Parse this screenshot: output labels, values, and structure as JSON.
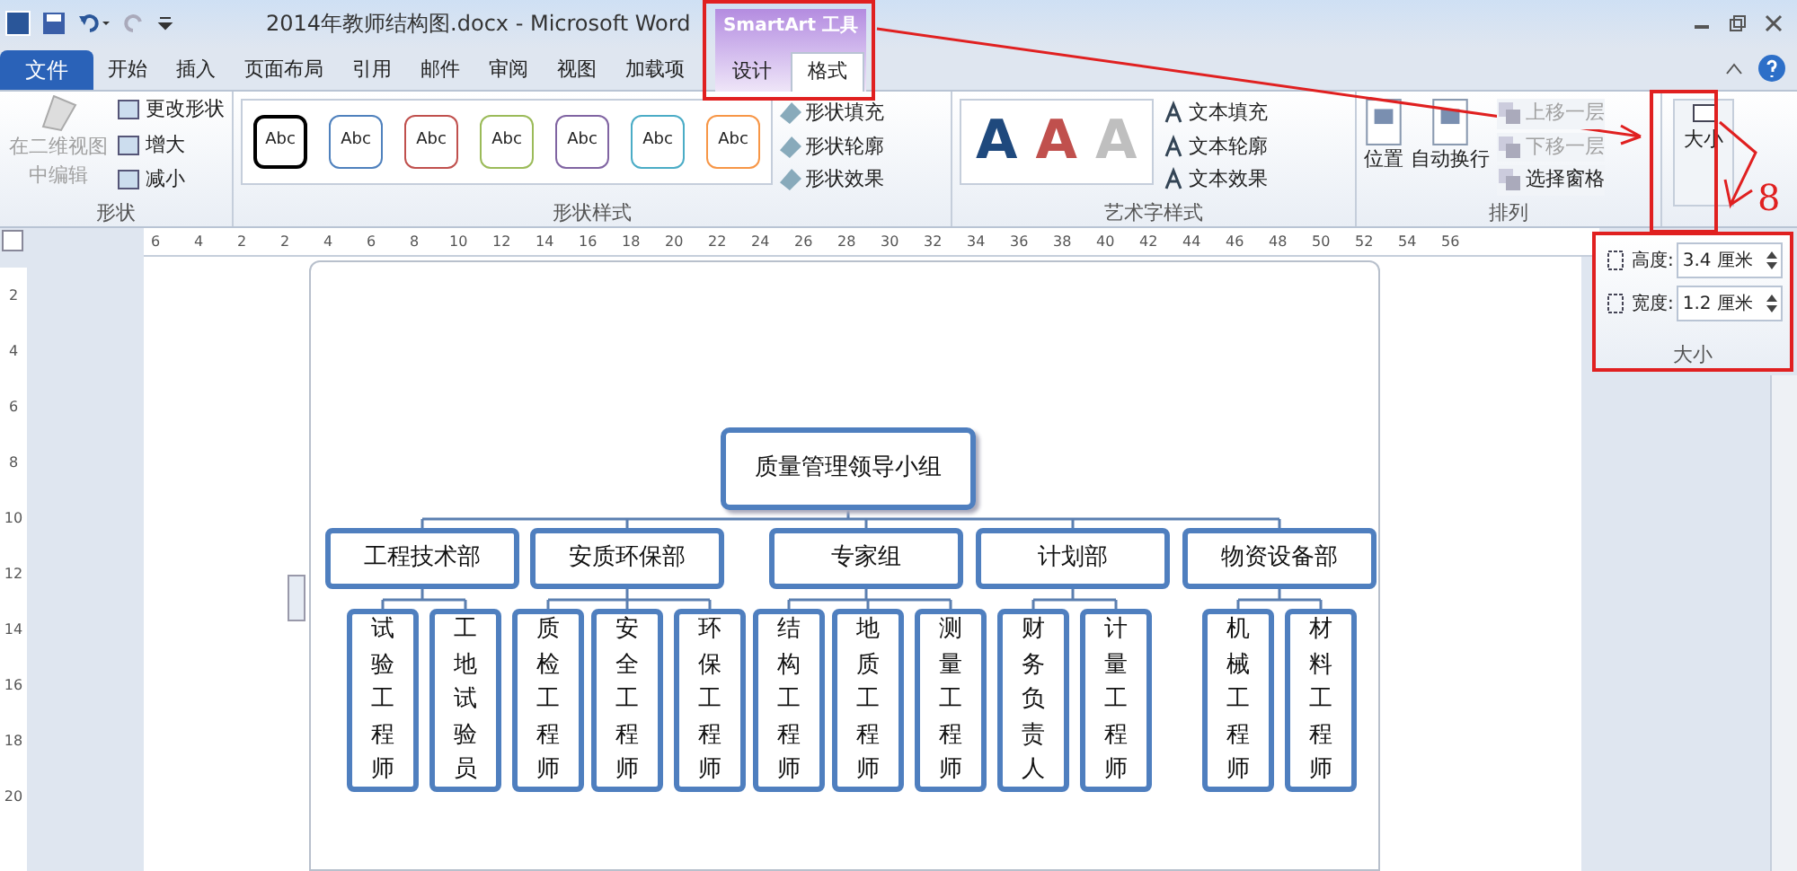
{
  "window": {
    "title": "2014年教师结构图.docx - Microsoft Word"
  },
  "contextual_group": {
    "title": "SmartArt 工具",
    "tabs": [
      {
        "label": "设计",
        "selected": false
      },
      {
        "label": "格式",
        "selected": true
      }
    ]
  },
  "ribbon_tabs": [
    {
      "label": "文件",
      "kind": "file",
      "selected": false
    },
    {
      "label": "开始",
      "kind": "tab",
      "selected": false
    },
    {
      "label": "插入",
      "kind": "tab",
      "selected": false
    },
    {
      "label": "页面布局",
      "kind": "tab",
      "selected": false
    },
    {
      "label": "引用",
      "kind": "tab",
      "selected": false
    },
    {
      "label": "邮件",
      "kind": "tab",
      "selected": false
    },
    {
      "label": "审阅",
      "kind": "tab",
      "selected": false
    },
    {
      "label": "视图",
      "kind": "tab",
      "selected": false
    },
    {
      "label": "加载项",
      "kind": "tab",
      "selected": false
    }
  ],
  "shape_group": {
    "title": "形状",
    "edit_button": {
      "label": "在二维视图中编辑",
      "disabled": true
    },
    "commands": [
      "更改形状",
      "增大",
      "减小"
    ]
  },
  "shape_styles": {
    "title": "形状样式",
    "swatches": [
      {
        "label": "Abc",
        "color": "#000000",
        "selected": true
      },
      {
        "label": "Abc",
        "color": "#4f81bd",
        "selected": false
      },
      {
        "label": "Abc",
        "color": "#c0504d",
        "selected": false
      },
      {
        "label": "Abc",
        "color": "#9bbb59",
        "selected": false
      },
      {
        "label": "Abc",
        "color": "#8064a2",
        "selected": false
      },
      {
        "label": "Abc",
        "color": "#4bacc6",
        "selected": false
      },
      {
        "label": "Abc",
        "color": "#f79646",
        "selected": false
      }
    ],
    "commands": [
      "形状填充",
      "形状轮廓",
      "形状效果"
    ]
  },
  "wordart_styles": {
    "title": "艺术字样式",
    "samples": [
      {
        "label": "A",
        "color": "#1f497d"
      },
      {
        "label": "A",
        "color": "#c0504d"
      },
      {
        "label": "A",
        "color": "#bfbfbf"
      }
    ],
    "commands": [
      "文本填充",
      "文本轮廓",
      "文本效果"
    ]
  },
  "arrange": {
    "title": "排列",
    "buttons": [
      "位置",
      "自动换行"
    ],
    "commands": [
      {
        "label": "上移一层",
        "disabled": true
      },
      {
        "label": "下移一层",
        "disabled": true
      },
      {
        "label": "选择窗格",
        "disabled": false
      }
    ]
  },
  "size_button": {
    "label": "大小"
  },
  "size_panel": {
    "title": "大小",
    "fields": [
      {
        "label": "高度:",
        "value": "3.4 厘米"
      },
      {
        "label": "宽度:",
        "value": "1.2 厘米"
      }
    ]
  },
  "ruler": {
    "horizontal": [
      "6",
      "4",
      "2",
      "2",
      "4",
      "6",
      "8",
      "10",
      "12",
      "14",
      "16",
      "18",
      "20",
      "22",
      "24",
      "26",
      "28",
      "30",
      "32",
      "34",
      "36",
      "38",
      "40",
      "42",
      "44",
      "46",
      "48",
      "50",
      "52",
      "54",
      "56"
    ],
    "vertical": [
      "2",
      "4",
      "6",
      "8",
      "10",
      "12",
      "14",
      "16",
      "18",
      "20"
    ]
  },
  "org_chart": {
    "root": "质量管理领导小组",
    "departments": [
      {
        "name": "工程技术部",
        "children": [
          "试验工程师",
          "工地试验员"
        ]
      },
      {
        "name": "安质环保部",
        "children": [
          "质检工程师",
          "安全工程师",
          "环保工程师"
        ]
      },
      {
        "name": "专家组",
        "children": [
          "结构工程师",
          "地质工程师",
          "测量工程师"
        ]
      },
      {
        "name": "计划部",
        "children": [
          "财务负责人",
          "计量工程师"
        ]
      },
      {
        "name": "物资设备部",
        "children": [
          "机械工程师",
          "材料工程师"
        ]
      }
    ]
  },
  "annotation": {
    "label": "8"
  }
}
